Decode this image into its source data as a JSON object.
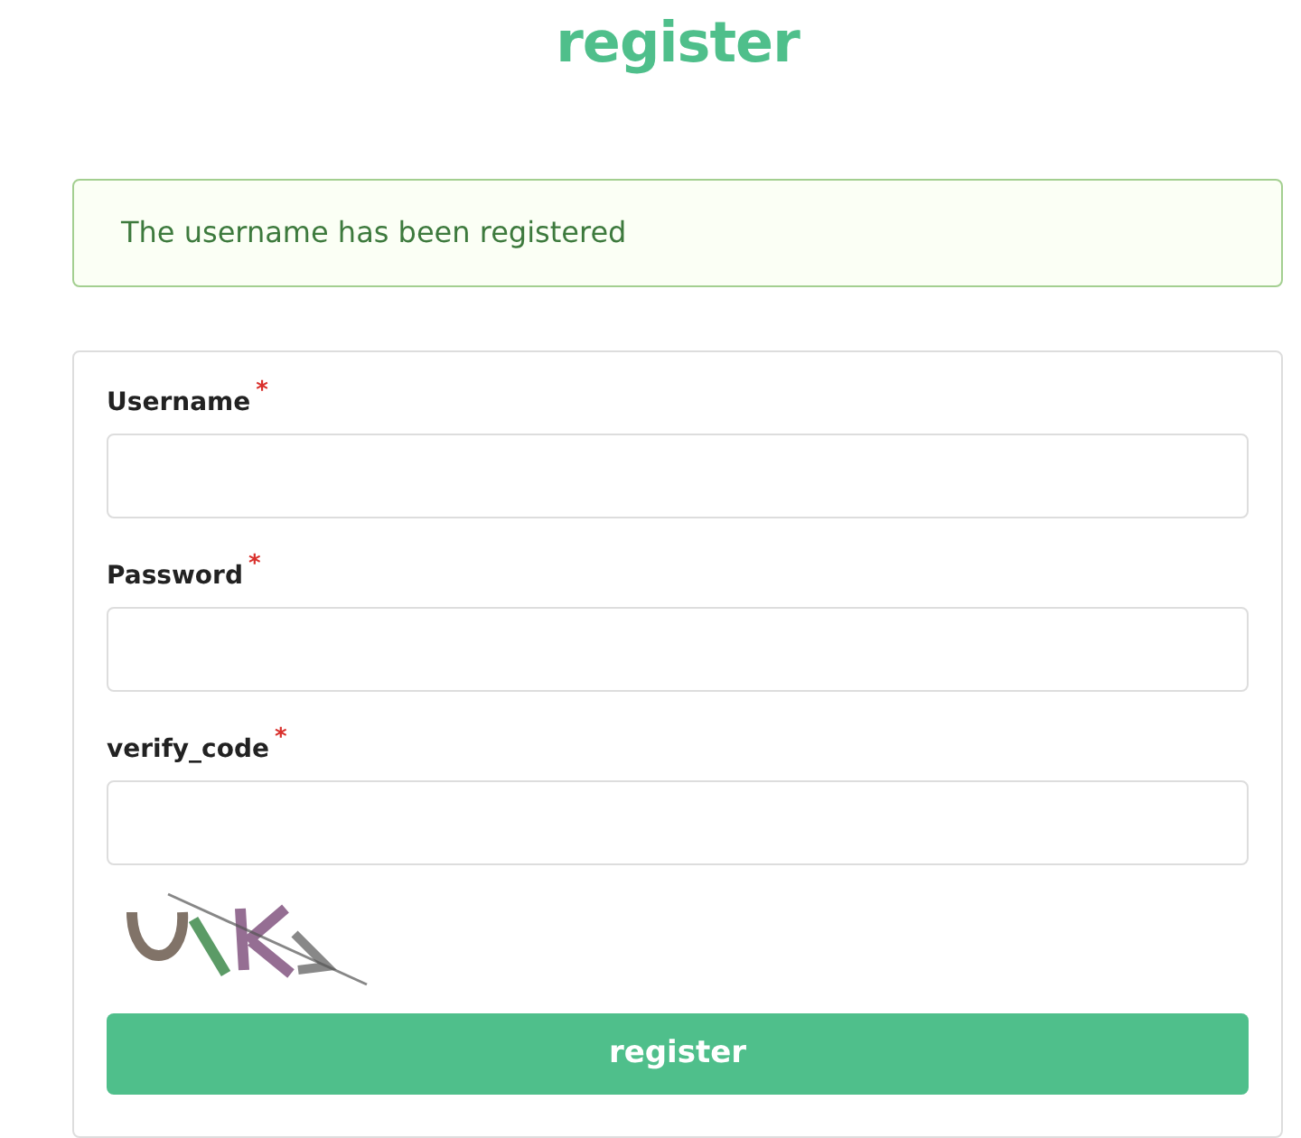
{
  "title": "register",
  "alert": {
    "message": "The username has been registered"
  },
  "fields": [
    {
      "label": "Username",
      "required_mark": "*"
    },
    {
      "label": "Password",
      "required_mark": "*"
    },
    {
      "label": "verify_code",
      "required_mark": "*"
    }
  ],
  "submit": {
    "label": "register"
  }
}
